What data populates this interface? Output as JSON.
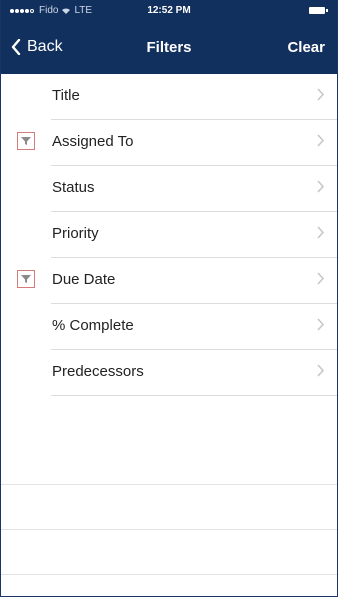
{
  "status_bar": {
    "carrier": "Fido",
    "network": "LTE",
    "time": "12:52 PM"
  },
  "nav": {
    "back_label": "Back",
    "title": "Filters",
    "clear_label": "Clear"
  },
  "filters": [
    {
      "label": "Title",
      "active": false
    },
    {
      "label": "Assigned To",
      "active": true
    },
    {
      "label": "Status",
      "active": false
    },
    {
      "label": "Priority",
      "active": false
    },
    {
      "label": "Due Date",
      "active": true
    },
    {
      "label": "% Complete",
      "active": false
    },
    {
      "label": "Predecessors",
      "active": false
    }
  ],
  "colors": {
    "nav_bg": "#12305e",
    "filter_icon_border": "#d47b7b",
    "chevron": "#c7c7cc"
  },
  "icons": {
    "back": "chevron-left-icon",
    "row": "chevron-right-icon",
    "active_filter": "funnel-icon"
  }
}
